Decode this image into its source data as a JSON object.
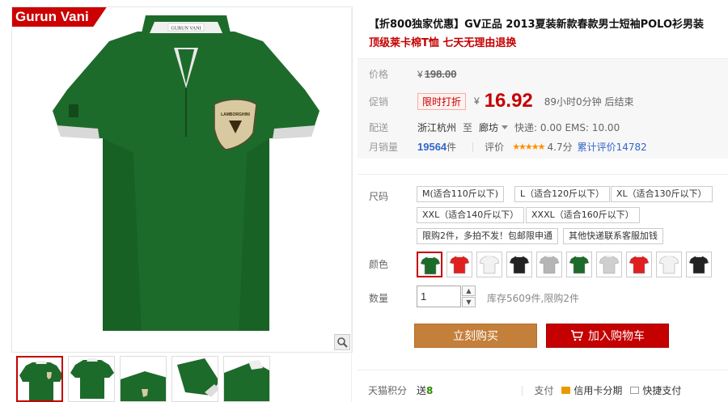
{
  "gallery": {
    "brand": "Gurun Vani",
    "collar_label": "GURUN VANI",
    "badge_text": "LAMBORGHINI"
  },
  "product": {
    "title": "【折800独家优惠】GV正品 2013夏装新款春款男士短袖POLO衫男装",
    "subtitle": "顶级莱卡棉T恤 七天无理由退换"
  },
  "price": {
    "label": "价格",
    "currency": "¥",
    "original": "198.00",
    "promo_label": "促销",
    "promo_badge": "限时打折",
    "promo_price": "16.92",
    "countdown": "89小时0分钟 后结束"
  },
  "shipping": {
    "label": "配送",
    "from": "浙江杭州",
    "to_word": "至",
    "to": "廊坊",
    "fee": "快递: 0.00 EMS: 10.00"
  },
  "sales": {
    "label": "月销量",
    "count": "19564",
    "unit": "件",
    "rating_label": "评价",
    "stars": "★★★★★",
    "score": "4.7分",
    "review_link": "累计评价14782"
  },
  "options": {
    "size_label": "尺码",
    "sizes": [
      "M(适合110斤以下)",
      "L（适合120斤以下）",
      "XL（适合130斤以下）",
      "XXL（适合140斤以下）",
      "XXXL（适合160斤以下）",
      "限购2件，多拍不发！包邮限申通",
      "其他快递联系客服加钱"
    ],
    "color_label": "颜色",
    "colors": [
      "#1d6b2a",
      "#e02020",
      "#f2f2f2",
      "#222222",
      "#b5b5b5",
      "#1d6b2a",
      "#cfcfcf",
      "#e02020",
      "#f2f2f2",
      "#222222"
    ],
    "qty_label": "数量",
    "qty_value": "1",
    "stock": "库存5609件,限购2件"
  },
  "actions": {
    "buy": "立刻购买",
    "cart": "加入购物车"
  },
  "footer": {
    "points_label": "天猫积分",
    "points_prefix": "送",
    "points_value": "8",
    "pay_label": "支付",
    "card_pay": "信用卡分期",
    "quick_pay": "快捷支付"
  },
  "colors": {
    "accent_red": "#c40000",
    "buy_brown": "#c47f3a",
    "shirt_green": "#1d6b2a",
    "link_blue": "#3366cc"
  }
}
